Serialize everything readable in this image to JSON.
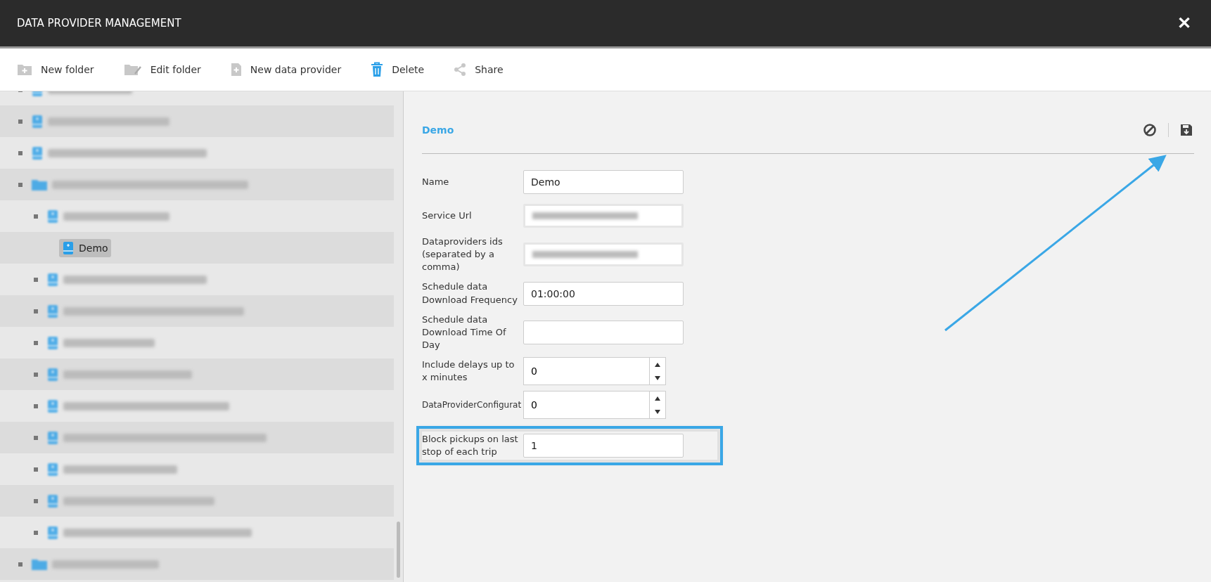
{
  "window": {
    "title": "DATA PROVIDER MANAGEMENT",
    "close": "✕"
  },
  "toolbar": [
    {
      "kind": "new-folder",
      "label": "New folder"
    },
    {
      "kind": "edit-folder",
      "label": "Edit folder"
    },
    {
      "kind": "new-provider",
      "label": "New data provider"
    },
    {
      "kind": "delete",
      "label": "Delete"
    },
    {
      "kind": "share",
      "label": "Share"
    }
  ],
  "tree": [
    {
      "kind": "provider",
      "selected": false
    },
    {
      "kind": "provider",
      "selected": false
    },
    {
      "kind": "provider",
      "selected": false
    },
    {
      "kind": "folder",
      "selected": false,
      "children": [
        {
          "kind": "provider",
          "selected": false,
          "children": [
            {
              "kind": "provider",
              "label": "Demo",
              "selected": true
            }
          ]
        },
        {
          "kind": "provider",
          "selected": false
        },
        {
          "kind": "provider",
          "selected": false
        },
        {
          "kind": "provider",
          "selected": false
        },
        {
          "kind": "provider",
          "selected": false
        },
        {
          "kind": "provider",
          "selected": false
        },
        {
          "kind": "provider",
          "selected": false
        },
        {
          "kind": "provider",
          "selected": false
        },
        {
          "kind": "provider",
          "selected": false
        },
        {
          "kind": "provider",
          "selected": false
        }
      ]
    },
    {
      "kind": "folder",
      "selected": false
    }
  ],
  "detail": {
    "title": "Demo",
    "fields": [
      {
        "kind": "text",
        "label": "Name",
        "value": "Demo",
        "highlighted": false
      },
      {
        "kind": "blurred",
        "label": "Service Url",
        "highlighted": false
      },
      {
        "kind": "blurred",
        "label": "Dataproviders ids (separated by a comma)",
        "highlighted": false
      },
      {
        "kind": "text",
        "label": "Schedule data Download Frequency",
        "value": "01:00:00",
        "highlighted": false
      },
      {
        "kind": "text",
        "label": "Schedule data Download Time Of Day",
        "highlighted": false
      },
      {
        "kind": "spinner",
        "label": "Include delays up to x minutes",
        "value": "0",
        "highlighted": false
      },
      {
        "kind": "spinner",
        "label": "DataProviderConfigurat",
        "value": "0",
        "highlighted": false
      },
      {
        "kind": "text",
        "label": "Block pickups on last stop of each trip",
        "value": "1",
        "highlighted": true
      }
    ]
  }
}
